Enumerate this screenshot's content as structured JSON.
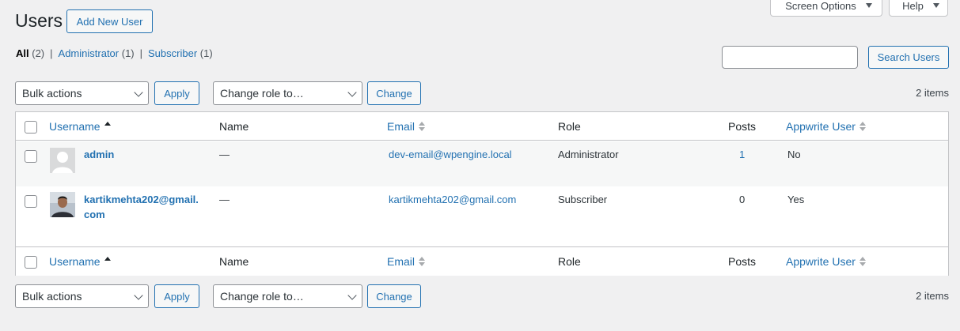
{
  "header": {
    "title": "Users",
    "add_new_label": "Add New User",
    "screen_options_label": "Screen Options",
    "help_label": "Help"
  },
  "filters": {
    "all_label": "All",
    "all_count": "(2)",
    "admin_label": "Administrator",
    "admin_count": "(1)",
    "subscriber_label": "Subscriber",
    "subscriber_count": "(1)",
    "separator": "|"
  },
  "search": {
    "value": "",
    "button_label": "Search Users"
  },
  "tablenav": {
    "bulk_actions": "Bulk actions",
    "apply_label": "Apply",
    "change_role": "Change role to…",
    "change_label": "Change",
    "items_count": "2 items"
  },
  "columns": {
    "username": "Username",
    "name": "Name",
    "email": "Email",
    "role": "Role",
    "posts": "Posts",
    "appwrite": "Appwrite User"
  },
  "rows": [
    {
      "username": "admin",
      "name": "—",
      "email": "dev-email@wpengine.local",
      "role": "Administrator",
      "posts": "1",
      "appwrite": "No"
    },
    {
      "username_line1": "kartikmehta202@gmail.",
      "username_line2": "com",
      "name": "—",
      "email": "kartikmehta202@gmail.com",
      "role": "Subscriber",
      "posts": "0",
      "appwrite": "Yes"
    }
  ],
  "colors": {
    "link": "#2271b1",
    "background": "#f0f0f1",
    "border": "#c3c4c7"
  }
}
